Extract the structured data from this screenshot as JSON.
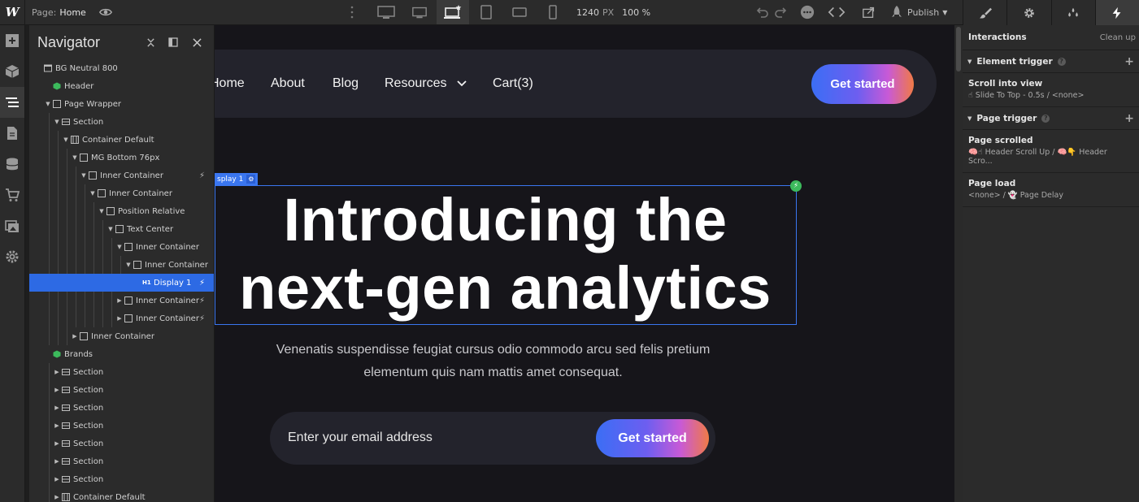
{
  "app": {
    "brand_glyph": "W",
    "accent": "#2d6ae4",
    "success": "#3cba5c"
  },
  "topbar": {
    "page_label": "Page:",
    "page_name": "Home",
    "canvas_width": "1240",
    "width_unit": "PX",
    "zoom": "100 %",
    "publish_label": "Publish"
  },
  "navigator": {
    "title": "Navigator",
    "items": [
      {
        "label": "BG Neutral 800"
      },
      {
        "label": "Header"
      },
      {
        "label": "Page Wrapper"
      },
      {
        "label": "Section"
      },
      {
        "label": "Container Default"
      },
      {
        "label": "MG Bottom 76px"
      },
      {
        "label": "Inner Container"
      },
      {
        "label": "Inner Container"
      },
      {
        "label": "Position Relative"
      },
      {
        "label": "Text Center"
      },
      {
        "label": "Inner Container"
      },
      {
        "label": "Inner Container"
      },
      {
        "label": "Display 1",
        "badge": "H1"
      },
      {
        "label": "Inner Container"
      },
      {
        "label": "Inner Container"
      },
      {
        "label": "Inner Container"
      },
      {
        "label": "Brands"
      },
      {
        "label": "Section"
      },
      {
        "label": "Section"
      },
      {
        "label": "Section"
      },
      {
        "label": "Section"
      },
      {
        "label": "Section"
      },
      {
        "label": "Section"
      },
      {
        "label": "Section"
      },
      {
        "label": "Container Default"
      }
    ]
  },
  "canvas": {
    "nav_links": [
      "Home",
      "About",
      "Blog",
      "Resources",
      "Cart(3)"
    ],
    "cta": "Get started",
    "selected_tag": "splay 1",
    "hero_line1": "Introducing the",
    "hero_line2": "next-gen analytics",
    "hero_sub_line1": "Venenatis suspendisse feugiat cursus odio commodo arcu sed  felis pretium",
    "hero_sub_line2": "elementum quis nam mattis amet consequat.",
    "email_placeholder": "Enter your email address",
    "email_cta": "Get started"
  },
  "interactions": {
    "title": "Interactions",
    "clean_up": "Clean up",
    "element_trigger": {
      "label": "Element trigger",
      "item": {
        "title": "Scroll into view",
        "detail": "☝ Slide To Top - 0.5s / <none>"
      }
    },
    "page_trigger": {
      "label": "Page trigger",
      "items": [
        {
          "title": "Page scrolled",
          "detail": "🧠☝ Header Scroll Up / 🧠👇 Header Scro..."
        },
        {
          "title": "Page load",
          "detail": "<none> / 👻 Page Delay"
        }
      ]
    }
  }
}
